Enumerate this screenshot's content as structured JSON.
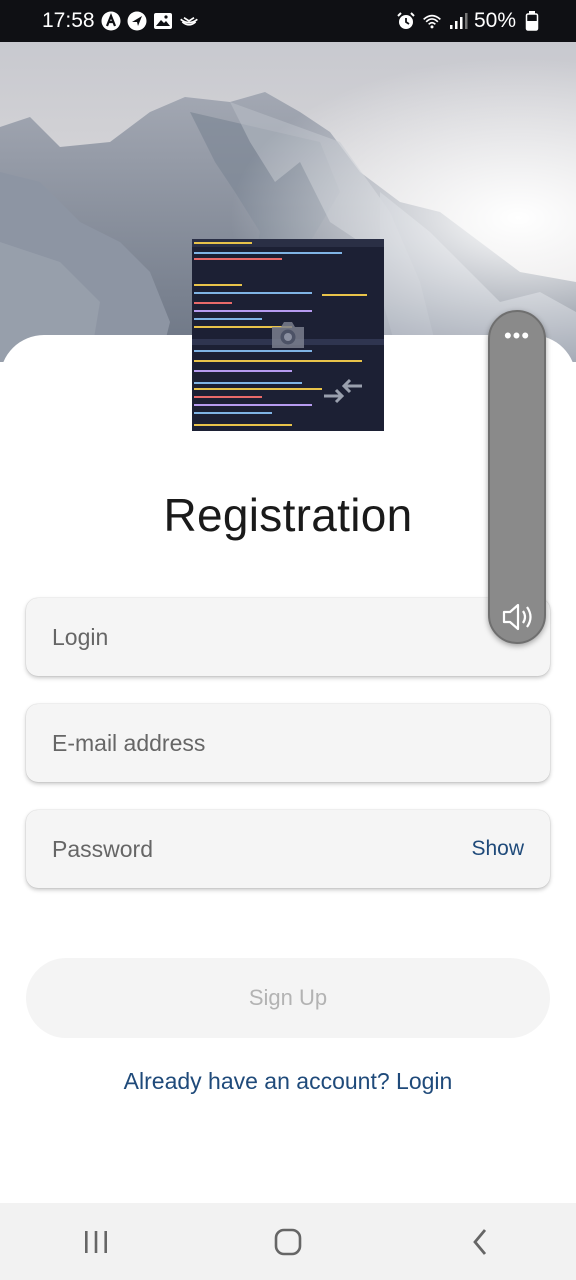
{
  "status_bar": {
    "time": "17:58",
    "battery": "50%",
    "left_icons": [
      "app-a-icon",
      "navigation-icon",
      "gallery-icon",
      "cast-icon"
    ],
    "right_icons": [
      "alarm-icon",
      "wifi-icon",
      "signal-icon",
      "battery-icon"
    ]
  },
  "form": {
    "title": "Registration",
    "login_placeholder": "Login",
    "email_placeholder": "E-mail address",
    "password_placeholder": "Password",
    "show_label": "Show",
    "signup_label": "Sign Up",
    "login_link": "Already have an account? Login"
  },
  "volume_panel": {
    "more_label": "•••"
  },
  "nav": {
    "icons": [
      "recent-apps-icon",
      "home-icon",
      "back-icon"
    ]
  },
  "colors": {
    "accent": "#1f4a7a",
    "field_bg": "#f5f5f5",
    "status_bar_bg": "#0f1014"
  }
}
